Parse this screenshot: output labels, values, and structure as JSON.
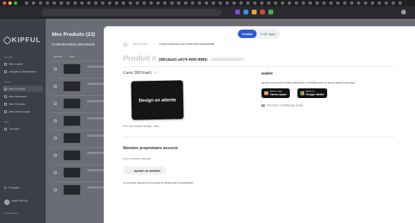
{
  "sidebar": {
    "brand": "KIPFUL",
    "sections": [
      "Accueil",
      "Gérer",
      "Aide"
    ],
    "items": [
      {
        "label": "Mes Leads"
      },
      {
        "label": "Insights & Statistiques"
      },
      {
        "label": "Mes Produits"
      },
      {
        "label": "Mes Membres"
      },
      {
        "label": "Mes Thèmes"
      },
      {
        "label": "Mes Avis Google"
      },
      {
        "label": "Tutoriels"
      }
    ],
    "language": "Français",
    "user_name": "David DUFON",
    "logout": "Déconnexion"
  },
  "main": {
    "title": "Mes Produits (23)",
    "selection": "0 sélectionné(s) sélectionné",
    "columns": [
      "Aperçu",
      "Nom"
    ]
  },
  "modal": {
    "toggle_active": "Produit",
    "toggle_inactive": "Profil digital",
    "breadcrumb": [
      "Mes Produits",
      "Produit #28516ad1-e674-400f-9969-ce8e46d6ffffff"
    ],
    "product_prefix": "Produit #",
    "product_id": "28516ad1-e674-400f-9969-",
    "card_label": "Carte 28516ad1",
    "card_text": "Design en attente",
    "card_sub": "PVC Sur-mesure Design - Noir",
    "wallet_title": "wallet",
    "wallet_desc": "Ajouter ce produit à votre portefeuille numérique pour un accès facile et sécurisé.",
    "apple_small": "Ajouter à l'app",
    "apple_big": "Cartes Apple",
    "google_small": "Ajouter au",
    "google_big": "Google Wallet",
    "email_wallet": "Recevoir le Wallet par email",
    "member_title": "Membre propriétaire associé",
    "member_none": "Aucun membre associé",
    "add_member": "Ajouter un membre",
    "member_note": "Le membre associé à ce produit en deviendra le propriétaire."
  }
}
